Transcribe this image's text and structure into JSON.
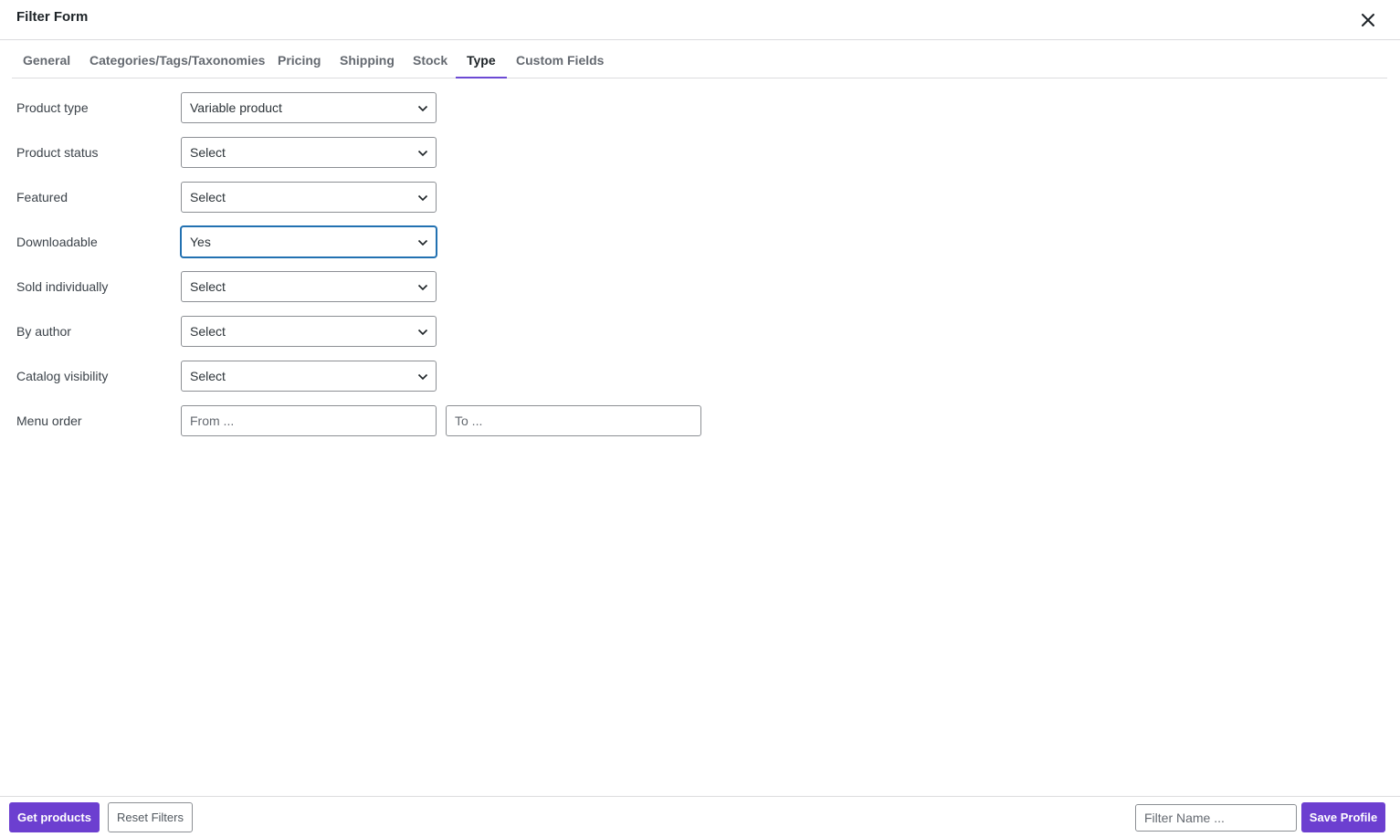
{
  "dialog": {
    "title": "Filter Form",
    "close_icon": "close-icon"
  },
  "tabs": [
    {
      "label": "General",
      "active": false
    },
    {
      "label": "Categories/Tags/Taxonomies",
      "active": false
    },
    {
      "label": "Pricing",
      "active": false
    },
    {
      "label": "Shipping",
      "active": false
    },
    {
      "label": "Stock",
      "active": false
    },
    {
      "label": "Type",
      "active": true
    },
    {
      "label": "Custom Fields",
      "active": false
    }
  ],
  "fields": {
    "product_type": {
      "label": "Product type",
      "value": "Variable product"
    },
    "product_status": {
      "label": "Product status",
      "value": "Select"
    },
    "featured": {
      "label": "Featured",
      "value": "Select"
    },
    "downloadable": {
      "label": "Downloadable",
      "value": "Yes"
    },
    "sold_individually": {
      "label": "Sold individually",
      "value": "Select"
    },
    "by_author": {
      "label": "By author",
      "value": "Select"
    },
    "catalog_visibility": {
      "label": "Catalog visibility",
      "value": "Select"
    },
    "menu_order": {
      "label": "Menu order",
      "from_placeholder": "From ...",
      "to_placeholder": "To ..."
    }
  },
  "footer": {
    "get_products": "Get products",
    "reset_filters": "Reset Filters",
    "filter_name_placeholder": "Filter Name ...",
    "save_profile": "Save Profile"
  },
  "colors": {
    "accent": "#6c3fd0",
    "focus": "#2271b1"
  }
}
